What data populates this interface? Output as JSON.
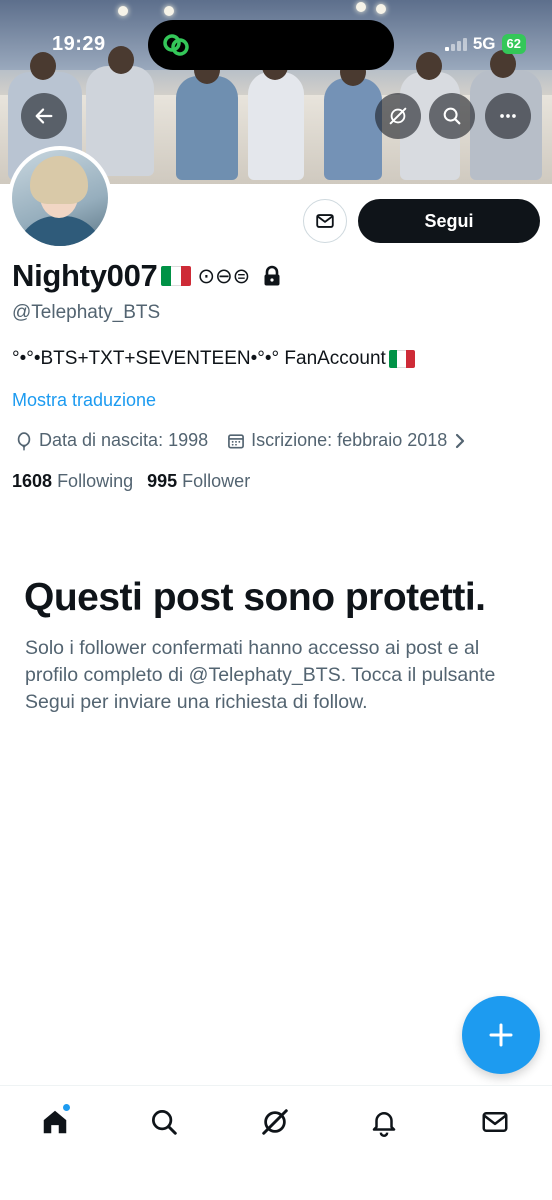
{
  "status_bar": {
    "time": "19:29",
    "network": "5G",
    "battery": "62"
  },
  "banner": {
    "back_icon": "arrow-left-icon",
    "grok_icon": "grok-icon",
    "search_icon": "search-icon",
    "more_icon": "more-horizontal-icon"
  },
  "profile": {
    "display_name": "Nighty007",
    "badge_glyphs": "⊙⊖⊜",
    "handle": "@Telephaty_BTS",
    "bio": "°•°•BTS+TXT+SEVENTEEN•°•° FanAccount",
    "translate_link": "Mostra traduzione",
    "birth": "Data di nascita: 1998",
    "joined": "Iscrizione: febbraio 2018",
    "following_count": "1608",
    "following_label": "Following",
    "followers_count": "995",
    "followers_label": "Follower"
  },
  "actions": {
    "follow_label": "Segui"
  },
  "protected": {
    "title": "Questi post sono protetti.",
    "body": "Solo i follower confermati hanno accesso ai post e al profilo completo di @Telephaty_BTS. Tocca il pulsante Segui per inviare una richiesta di follow."
  },
  "bottom_nav": [
    "home-icon",
    "search-icon",
    "grok-icon",
    "notifications-icon",
    "messages-icon"
  ],
  "colors": {
    "accent": "#1d9bf0",
    "text": "#0f1419",
    "secondary": "#536471",
    "flag_green": "#009246",
    "flag_white": "#ffffff",
    "flag_red": "#ce2b37"
  }
}
